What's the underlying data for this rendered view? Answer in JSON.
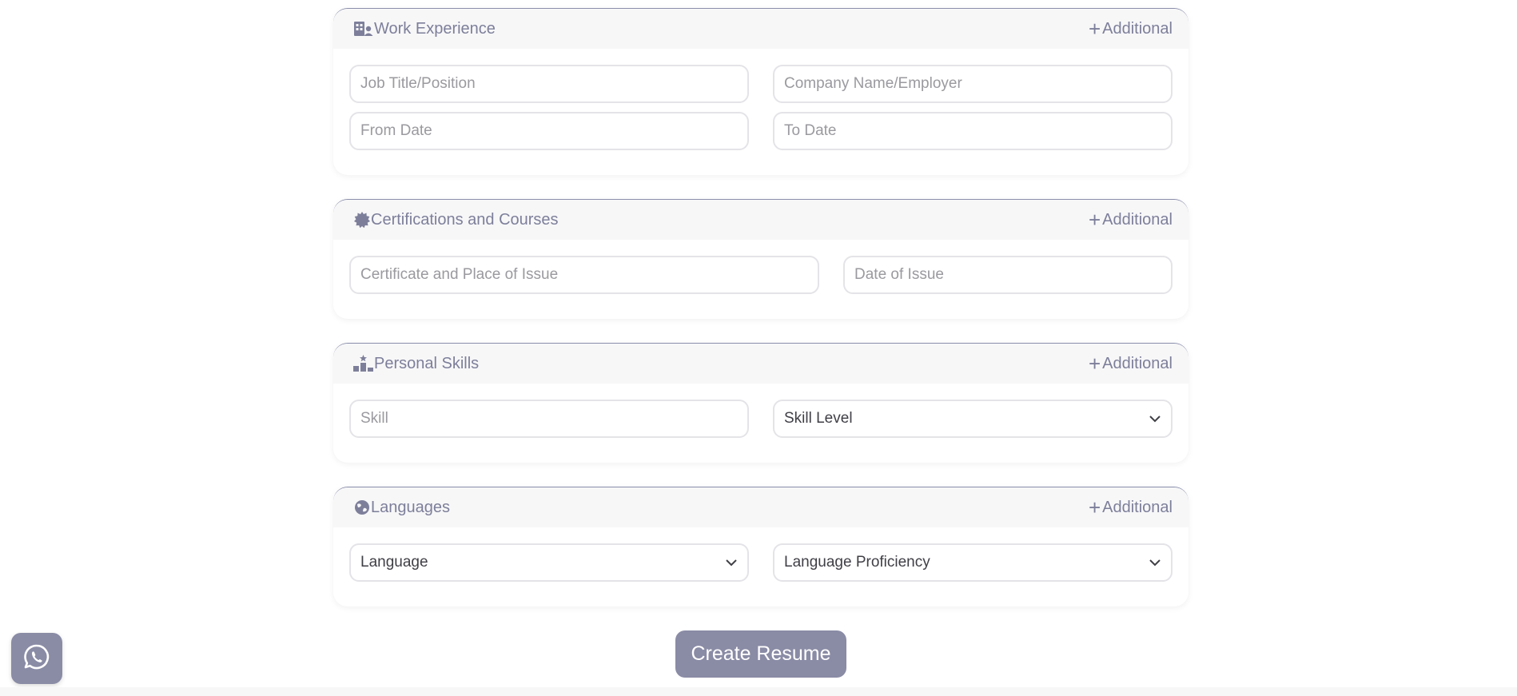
{
  "colors": {
    "accent": "#8a8ca6",
    "header_bg": "#f7f7f8",
    "border": "#e4e4e8"
  },
  "work_experience": {
    "title": "Work Experience",
    "icon": "building-user-icon",
    "additional_label": "Additional",
    "job_title_placeholder": "Job Title/Position",
    "company_placeholder": "Company Name/Employer",
    "from_date_placeholder": "From Date",
    "to_date_placeholder": "To Date"
  },
  "certifications": {
    "title": "Certifications and Courses",
    "icon": "certificate-icon",
    "additional_label": "Additional",
    "certificate_placeholder": "Certificate and Place of Issue",
    "date_placeholder": "Date of Issue"
  },
  "skills": {
    "title": "Personal Skills",
    "icon": "ranking-icon",
    "additional_label": "Additional",
    "skill_placeholder": "Skill",
    "skill_level_value": "Skill Level"
  },
  "languages": {
    "title": "Languages",
    "icon": "globe-icon",
    "additional_label": "Additional",
    "language_value": "Language",
    "proficiency_value": "Language Proficiency"
  },
  "actions": {
    "create_label": "Create Resume"
  },
  "whatsapp": {
    "icon": "whatsapp-icon"
  }
}
